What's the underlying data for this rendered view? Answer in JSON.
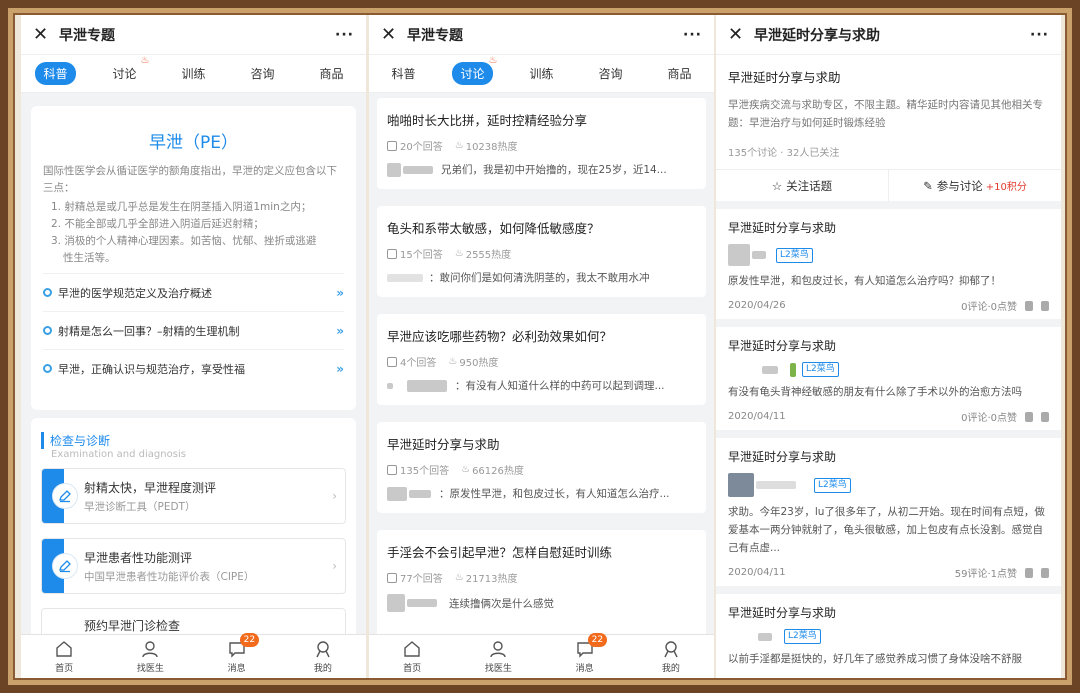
{
  "panels": {
    "p1": {
      "title": "早泄专题",
      "tabs": [
        "科普",
        "讨论",
        "训练",
        "咨询",
        "商品"
      ],
      "pe": {
        "title": "早泄（PE）",
        "intro": "国际性医学会从循证医学的额角度指出，早泄的定义应包含以下三点：",
        "points": [
          "1. 射精总是或几乎总是发生在阴茎插入阴道1min之内；",
          "2. 不能全部或几乎全部进入阴道后延迟射精；",
          "3. 消极的个人精神心理因素。如苦恼、忧郁、挫折或逃避",
          "性生活等。"
        ],
        "links": [
          "早泄的医学规范定义及治疗概述",
          "射精是怎么一回事？–射精的生理机制",
          "早泄，正确认识与规范治疗，享受性福"
        ]
      },
      "section": {
        "title": "检查与诊断",
        "subtitle": "Examination and diagnosis"
      },
      "tools": [
        {
          "name": "射精太快，早泄程度测评",
          "sub": "早泄诊断工具（PEDT）"
        },
        {
          "name": "早泄患者性功能测评",
          "sub": "中国早泄患者性功能评价表（CIPE）"
        },
        {
          "name": "预约早泄门诊检查",
          "sub": ""
        }
      ]
    },
    "p2": {
      "title": "早泄专题",
      "tabs": [
        "科普",
        "讨论",
        "训练",
        "咨询",
        "商品"
      ],
      "posts": [
        {
          "title": "啪啪时长大比拼，延时控精经验分享",
          "replies": "20个回答",
          "heat": "10238热度",
          "excerpt": "兄弟们，我是初中开始撸的，现在25岁，近14..."
        },
        {
          "title": "龟头和系带太敏感，如何降低敏感度？",
          "replies": "15个回答",
          "heat": "2555热度",
          "excerpt": "：敢问你们是如何清洗阴茎的，我太不敢用水冲"
        },
        {
          "title": "早泄应该吃哪些药物？必利劲效果如何？",
          "replies": "4个回答",
          "heat": "950热度",
          "excerpt": "：有没有人知道什么样的中药可以起到调理..."
        },
        {
          "title": "早泄延时分享与求助",
          "replies": "135个回答",
          "heat": "66126热度",
          "excerpt": "：原发性早泄，和包皮过长，有人知道怎么治疗..."
        },
        {
          "title": "手淫会不会引起早泄？怎样自慰延时训练",
          "replies": "77个回答",
          "heat": "21713热度",
          "excerpt": "连续撸俩次是什么感觉"
        }
      ]
    },
    "p3": {
      "title": "早泄延时分享与求助",
      "topic": {
        "title": "早泄延时分享与求助",
        "desc": "早泄疾病交流与求助专区，不限主题。精华延时内容请见其他相关专题：早泄治疗与如何延时锻炼经验",
        "stats": "135个讨论 · 32人已关注",
        "follow": "关注话题",
        "join": "参与讨论",
        "points": "+10积分"
      },
      "entries": [
        {
          "title": "早泄延时分享与求助",
          "level": "L2菜鸟",
          "text": "原发性早泄，和包皮过长，有人知道怎么治疗吗？抑郁了！",
          "date": "2020/04/26",
          "stats": "0评论·0点赞"
        },
        {
          "title": "早泄延时分享与求助",
          "level": "L2菜鸟",
          "text": "有没有龟头背神经敏感的朋友有什么除了手术以外的治愈方法吗",
          "date": "2020/04/11",
          "stats": "0评论·0点赞"
        },
        {
          "title": "早泄延时分享与求助",
          "level": "L2菜鸟",
          "text": "求助。今年23岁，lu了很多年了，从初二开始。现在时间有点短，做爱基本一两分钟就射了，龟头很敏感，加上包皮有点长没割。感觉自己有点虚...",
          "date": "2020/04/11",
          "stats": "59评论·1点赞"
        },
        {
          "title": "早泄延时分享与求助",
          "level": "L2菜鸟",
          "text": "以前手淫都是挺快的，好几年了感觉养成习惯了身体没啥不舒服",
          "date": "",
          "stats": ""
        }
      ]
    }
  },
  "nav": {
    "items": [
      "首页",
      "找医生",
      "消息",
      "我的"
    ],
    "badge": "22"
  },
  "colors": {
    "accent": "#1e8bea",
    "badge": "#f26b1d",
    "points": "#e23b2e"
  }
}
